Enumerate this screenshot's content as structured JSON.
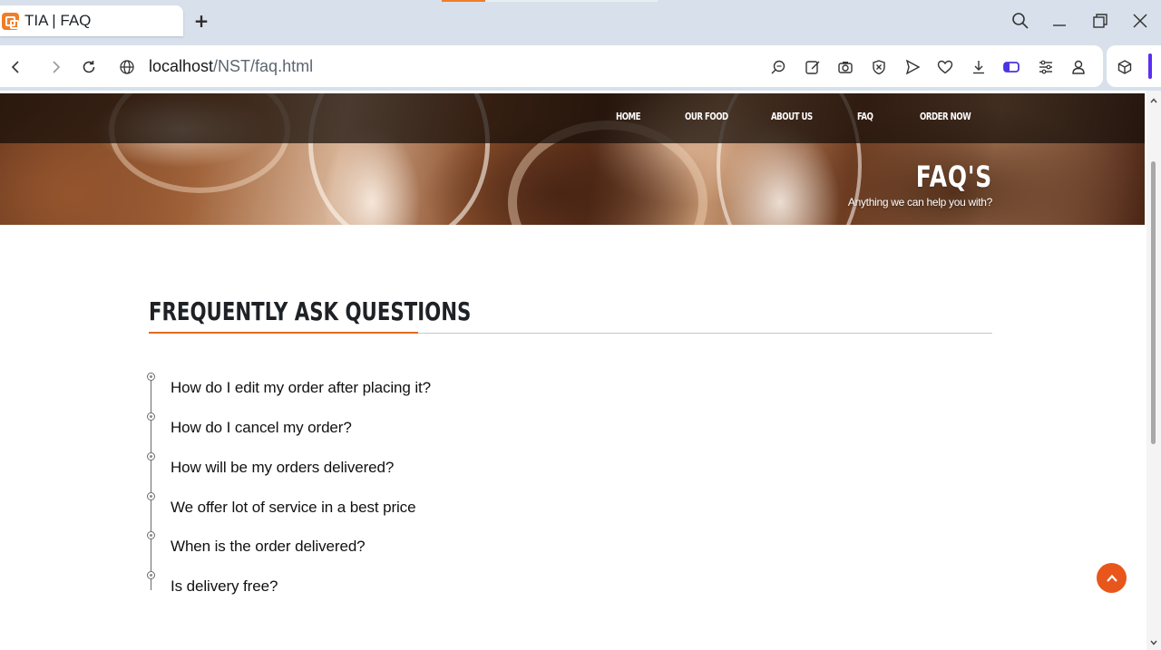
{
  "browser": {
    "tab_title": "TIA | FAQ",
    "new_tab_label": "+",
    "url_host": "localhost",
    "url_path": "/NST/faq.html",
    "accent_color": "#f07d28"
  },
  "site": {
    "nav": [
      "HOME",
      "OUR FOOD",
      "ABOUT US",
      "FAQ",
      "ORDER NOW"
    ],
    "hero_title": "FAQ'S",
    "hero_subtitle": "Anything we can help you with?",
    "section_title": "FREQUENTLY ASK QUESTIONS",
    "accent_color": "#e06a1f",
    "faqs": [
      "How do I edit my order after placing it?",
      "How do I cancel my order?",
      "How will be my orders delivered?",
      "We offer lot of service in a best price",
      "When is the order delivered?",
      "Is delivery free?"
    ]
  }
}
